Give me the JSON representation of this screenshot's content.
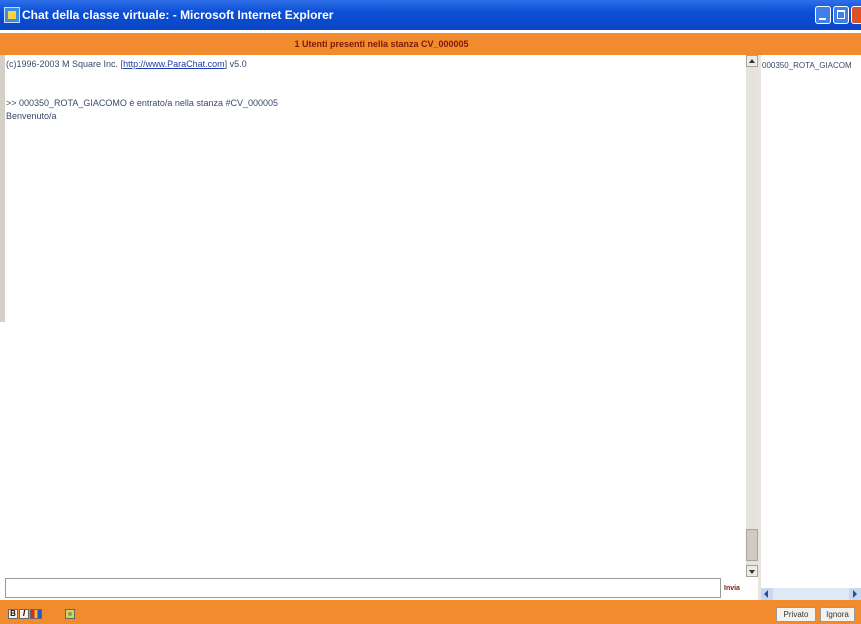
{
  "window": {
    "title": "Chat della classe virtuale: - Microsoft Internet Explorer",
    "controls": {
      "minimize": "minimize-icon",
      "maximize": "maximize-icon",
      "close": "close-icon"
    }
  },
  "header": {
    "room_status": "1 Utenti presenti nella stanza CV_000005"
  },
  "chat": {
    "copyright_prefix": "(c)1996-2003 M Square Inc. [",
    "copyright_link": "http://www.ParaChat.com",
    "copyright_suffix": "] v5.0",
    "messages": [
      ">> 000350_ROTA_GIACOMO è entrato/a nella stanza #CV_000005",
      "Benvenuto/a"
    ]
  },
  "users": {
    "list": [
      "000350_ROTA_GIACOM"
    ]
  },
  "input": {
    "value": "",
    "placeholder": ""
  },
  "send_label": "Invia",
  "toolbar": {
    "bold_label": "B",
    "italic_label": "I",
    "icons": {
      "color": "color-picker-icon",
      "emoticon": "emoticon-icon"
    }
  },
  "buttons": {
    "private_label": "Privato",
    "ignore_label": "Ignora"
  },
  "colors": {
    "title_bar": "#0c4fd6",
    "accent": "#f28a2e",
    "header_text": "#7a1b0a",
    "chat_text": "#3a4a6a",
    "link": "#1d3ea8"
  }
}
